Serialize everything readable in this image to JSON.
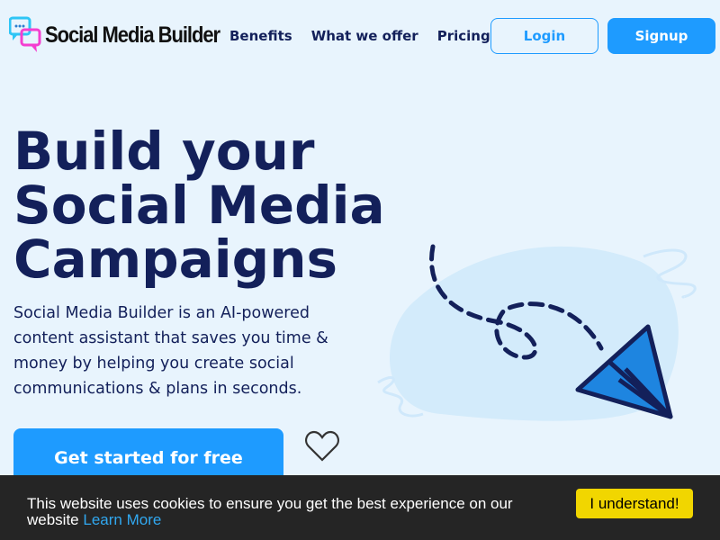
{
  "header": {
    "logo_text": "Social Media Builder",
    "nav": [
      {
        "label": "Benefits"
      },
      {
        "label": "What we offer"
      },
      {
        "label": "Pricing"
      }
    ],
    "login_label": "Login",
    "signup_label": "Signup"
  },
  "hero": {
    "title_lines": [
      "Build your",
      "Social Media",
      "Campaigns"
    ],
    "description": "Social Media Builder is an AI-powered content assistant that saves you time & money by helping you create social communications & plans in seconds.",
    "cta_label": "Get started for free",
    "favorite_icon": "heart-icon"
  },
  "cookie_banner": {
    "message": "This website uses cookies to ensure you get the best experience on our website",
    "learn_more": "Learn More",
    "accept_label": "I understand!"
  },
  "colors": {
    "primary": "#1e9bff",
    "navy": "#13205a",
    "background": "#e8f4fd",
    "cookie_bg": "#252525",
    "cookie_button": "#f1d600"
  }
}
